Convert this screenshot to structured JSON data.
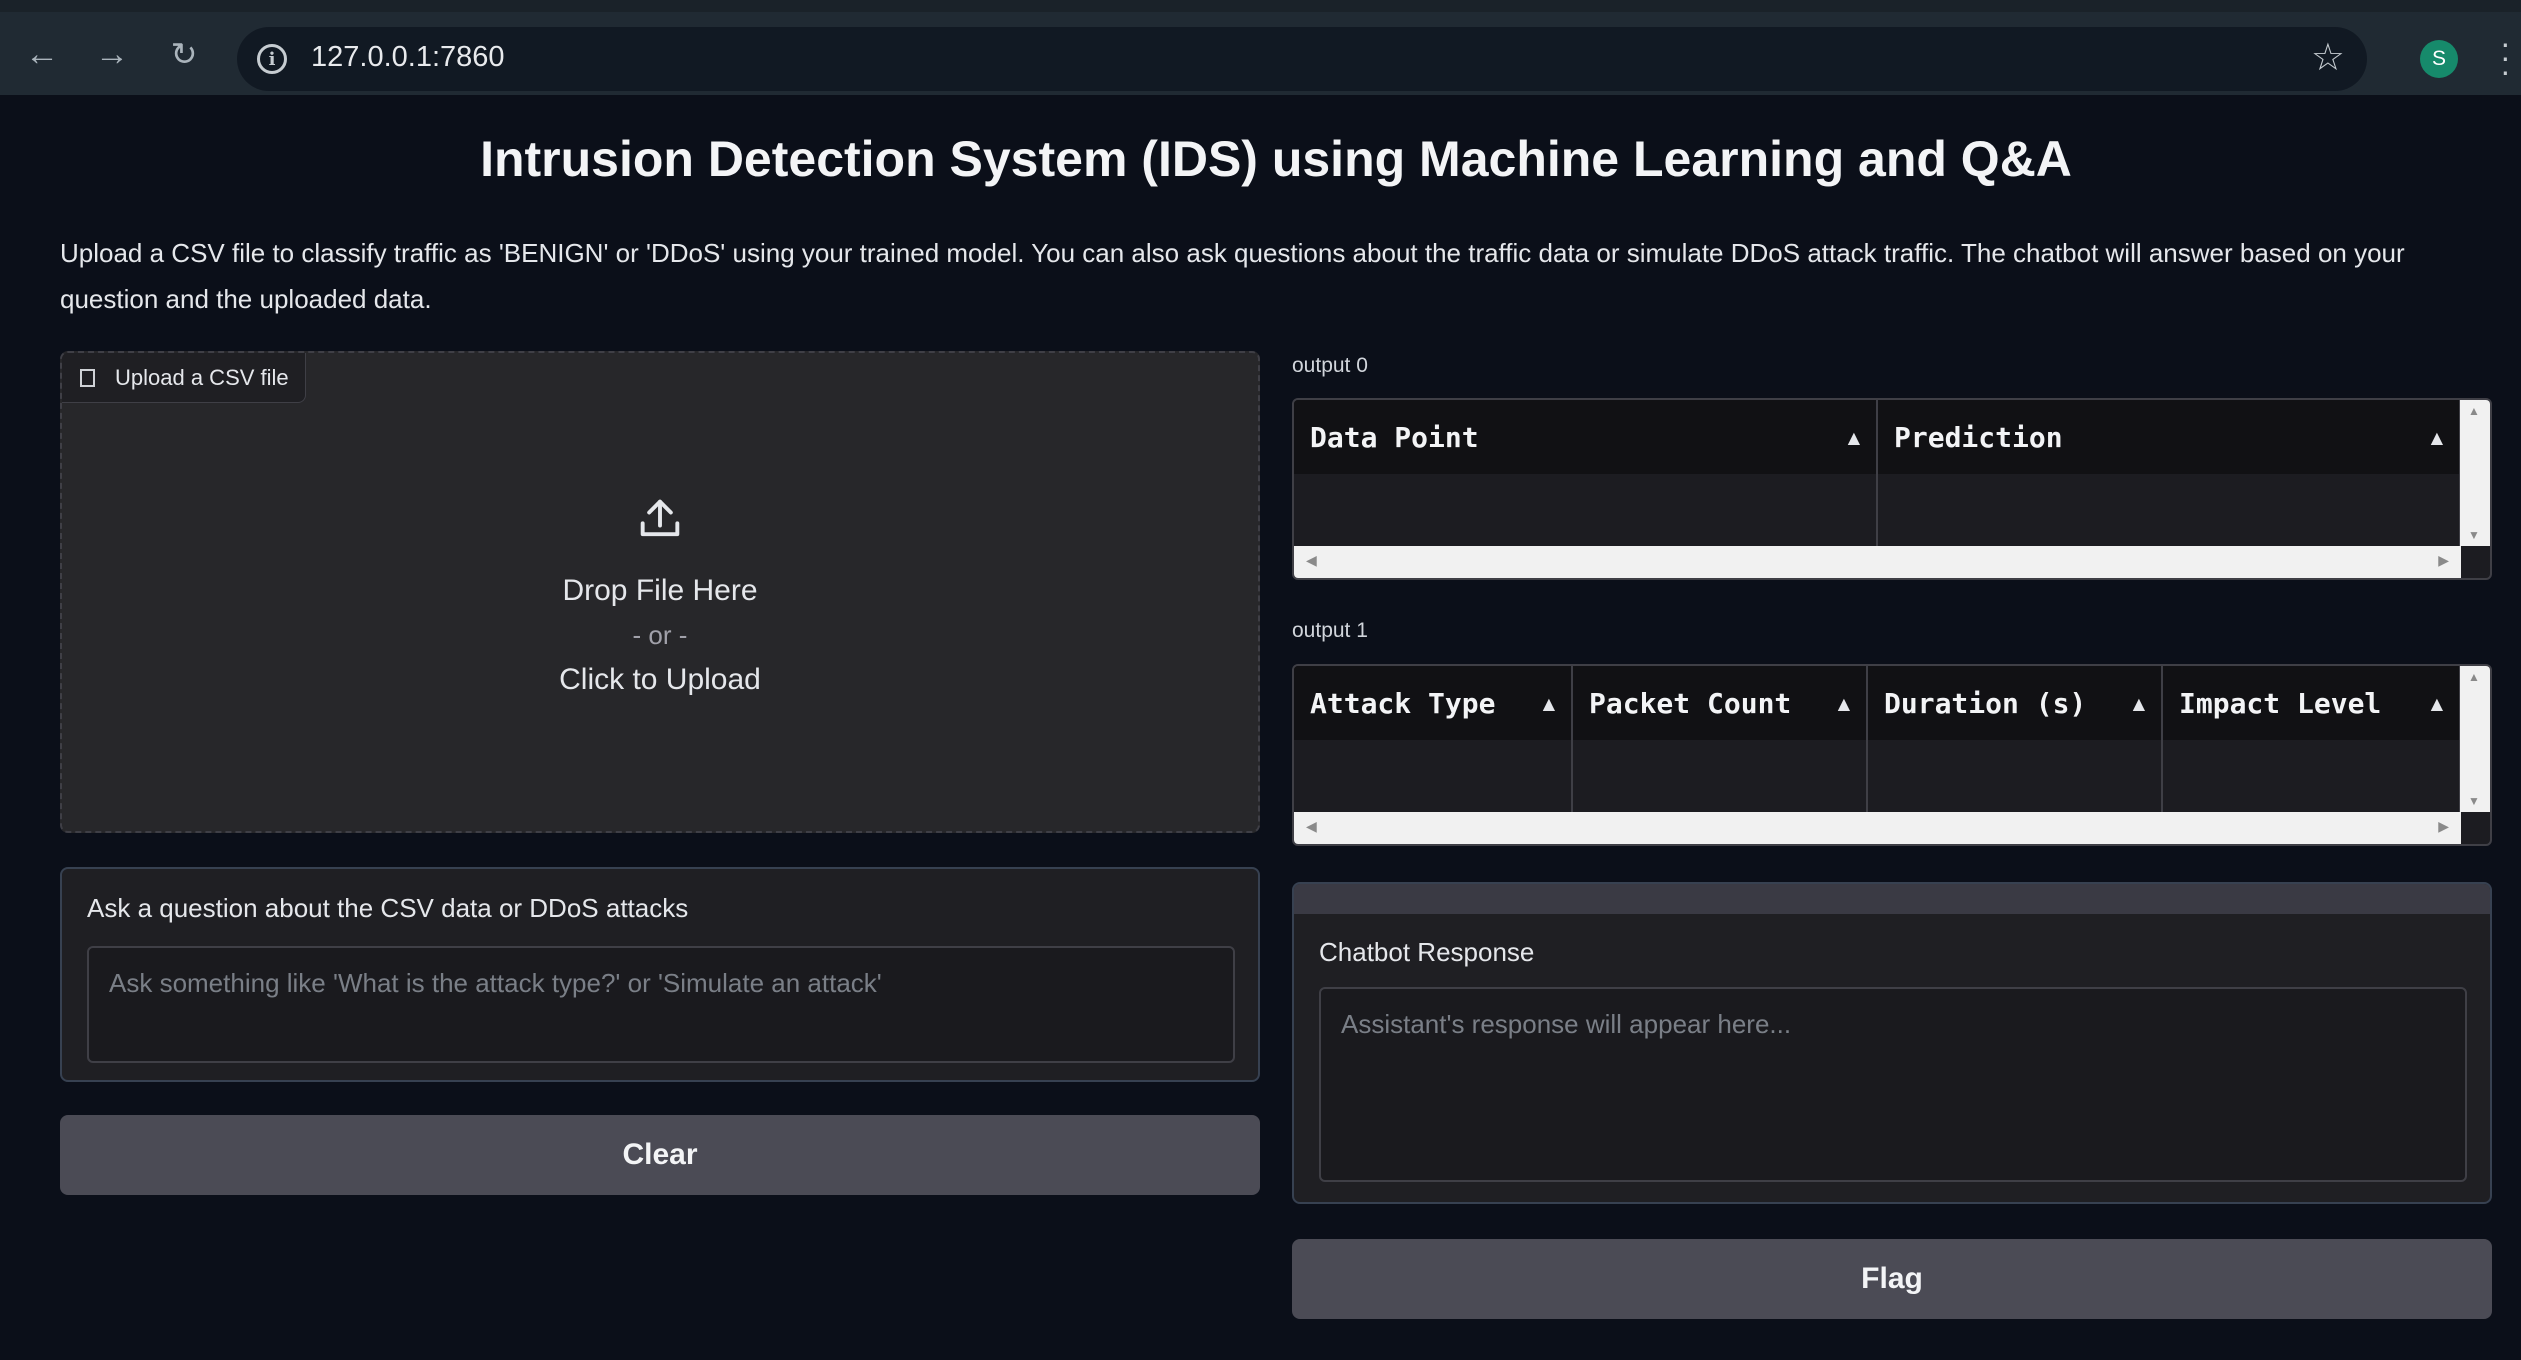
{
  "browser": {
    "url": "127.0.0.1:7860",
    "avatar_letter": "S",
    "icons": [
      "back-icon",
      "forward-icon",
      "reload-icon",
      "info-icon",
      "star-icon",
      "kebab-menu-icon"
    ]
  },
  "page": {
    "title": "Intrusion Detection System (IDS) using Machine Learning and Q&A",
    "description": "Upload a CSV file to classify traffic as 'BENIGN' or 'DDoS' using your trained model. You can also ask questions about the traffic data or simulate DDoS attack traffic. The chatbot will answer based on your question and the uploaded data."
  },
  "upload": {
    "label": "Upload a CSV file",
    "drop_text": "Drop File Here",
    "or_text": "- or -",
    "click_text": "Click to Upload"
  },
  "question": {
    "label": "Ask a question about the CSV data or DDoS attacks",
    "placeholder": "Ask something like 'What is the attack type?' or 'Simulate an attack'"
  },
  "buttons": {
    "clear": "Clear",
    "flag": "Flag"
  },
  "output0": {
    "label": "output 0",
    "columns": [
      "Data Point",
      "Prediction"
    ]
  },
  "output1": {
    "label": "output 1",
    "columns": [
      "Attack Type",
      "Packet Count",
      "Duration (s)",
      "Impact Level"
    ]
  },
  "chatbot": {
    "label": "Chatbot Response",
    "placeholder": "Assistant's response will appear here..."
  },
  "colors": {
    "background": "#0b0f19",
    "panel": "#1f1f23",
    "button": "#4b4b55",
    "avatar": "#168a6b"
  }
}
